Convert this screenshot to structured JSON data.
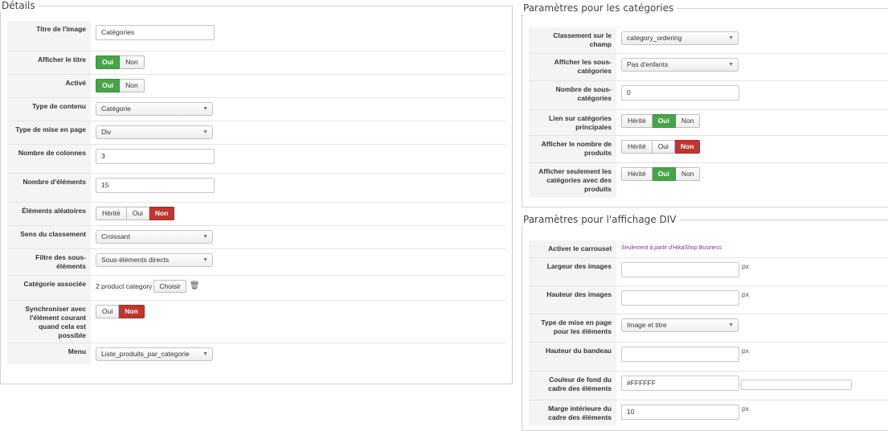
{
  "details": {
    "legend": "Détails",
    "title_label": "Titre de l'image",
    "title_value": "Catégories",
    "show_title_label": "Afficher le titre",
    "active_label": "Activé",
    "content_type_label": "Type de contenu",
    "content_type_value": "Catégorie",
    "layout_type_label": "Type de mise en page",
    "layout_type_value": "Div",
    "columns_label": "Nombre de colonnes",
    "columns_value": "3",
    "elements_label": "Nombre d'éléments",
    "elements_value": "15",
    "random_label": "Éléments aléatoires",
    "order_dir_label": "Sens du classement",
    "order_dir_value": "Croissant",
    "subfilter_label": "Filtre des sous-éléments",
    "subfilter_value": "Sous-éléments directs",
    "assoc_cat_label": "Catégorie associée",
    "assoc_cat_value": "2 product category",
    "choose_label": "Choisir",
    "sync_label": "Synchroniser avec l'élément courant quand cela est possible",
    "menu_label": "Menu",
    "menu_value": "Liste_produits_par_categorie"
  },
  "common": {
    "yes": "Oui",
    "no": "Non",
    "inherit": "Hérité"
  },
  "category_params": {
    "legend": "Paramètres pour les catégories",
    "sort_field_label": "Classement sur le champ",
    "sort_field_value": "category_ordering",
    "show_sub_label": "Afficher les sous-catégories",
    "show_sub_value": "Pas d'enfants",
    "sub_count_label": "Nombre de sous-catégories",
    "sub_count_value": "0",
    "link_main_label": "Lien sur catégories principales",
    "show_count_label": "Afficher le nombre de produits",
    "only_with_label": "Afficher seulement les catégories avec des produits"
  },
  "div_params": {
    "legend": "Paramètres pour l'affichage DIV",
    "carousel_label": "Activer le carrousel",
    "carousel_note": "Seulement à partir d'HikaShop Business",
    "img_width_label": "Largeur des images",
    "img_height_label": "Hauteur des images",
    "layout_label": "Type de mise en page pour les éléments",
    "layout_value": "Image et titre",
    "banner_height_label": "Hauteur du bandeau",
    "bg_color_label": "Couleur de fond du cadre des éléments",
    "bg_color_value": "#FFFFFF",
    "padding_label": "Marge intérieure du cadre des éléments",
    "padding_value": "10",
    "unit_px": "px"
  },
  "colors": {
    "yes_active": "#46a546",
    "no_active": "#bd362f"
  }
}
